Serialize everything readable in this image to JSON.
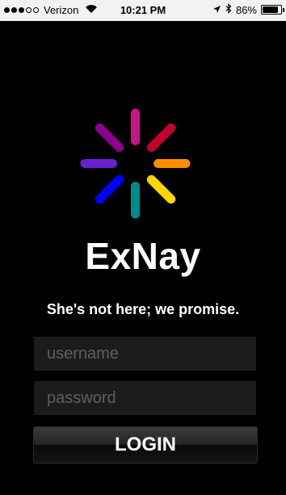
{
  "status_bar": {
    "carrier": "Verizon",
    "signal_strength": 3,
    "signal_max": 5,
    "time": "10:21 PM",
    "battery_percent": "86%",
    "battery_level": 0.86,
    "icons": [
      "wifi-icon",
      "location-icon",
      "bluetooth-icon",
      "battery-icon"
    ]
  },
  "logo": {
    "spoke_colors": [
      "#c2002c",
      "#ff8c00",
      "#ffd700",
      "#008b8b",
      "#0000ff",
      "#6a1fd1",
      "#8b008b",
      "#c71585"
    ]
  },
  "app": {
    "title": "ExNay",
    "tagline": "She's not here; we promise."
  },
  "form": {
    "username_placeholder": "username",
    "password_placeholder": "password",
    "login_label": "LOGIN"
  },
  "colors": {
    "background": "#000000",
    "field_background": "#1c1c1c",
    "status_bar": "#f2f2f2"
  }
}
